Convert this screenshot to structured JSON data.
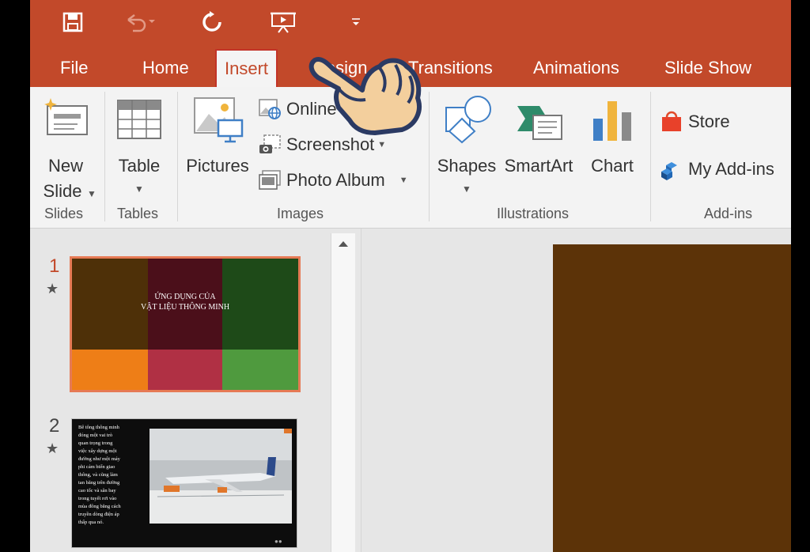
{
  "tabs": [
    "File",
    "Home",
    "Insert",
    "Design",
    "Transitions",
    "Animations",
    "Slide Show"
  ],
  "active_tab": "Insert",
  "quick_access": [
    "save-icon",
    "undo-icon",
    "redo-icon",
    "present-icon",
    "customize-icon"
  ],
  "ribbon": {
    "slides": {
      "new_slide_line1": "New",
      "new_slide_line2": "Slide",
      "label": "Slides"
    },
    "tables": {
      "table": "Table",
      "label": "Tables"
    },
    "images": {
      "pictures": "Pictures",
      "online": "Online",
      "screenshot": "Screenshot",
      "photo_album": "Photo Album",
      "label": "Images"
    },
    "illustrations": {
      "shapes": "Shapes",
      "smartart": "SmartArt",
      "chart": "Chart",
      "label": "Illustrations"
    },
    "addins": {
      "store": "Store",
      "my_addins": "My Add-ins",
      "label": "Add-ins"
    }
  },
  "thumbnails": [
    {
      "number": "1",
      "title_line1": "ỨNG DỤNG CỦA",
      "title_line2": "VẬT LIỆU THÔNG MINH"
    },
    {
      "number": "2",
      "text": [
        "Bê tông thông minh",
        "đóng một vai trò",
        "quan trọng trong",
        "việc xây dựng một",
        "đường như một máy",
        "phi cảm biến giao",
        "thông, và cũng làm",
        "tan băng trên đường",
        "cao tốc và sân bay",
        "trong tuyết rơi vào",
        "mùa đông bằng cách",
        "truyền dòng điện áp",
        "thấp qua nó."
      ]
    }
  ],
  "colors": {
    "accent": "#c2492a",
    "main_slide_bg": "#5c3308"
  }
}
